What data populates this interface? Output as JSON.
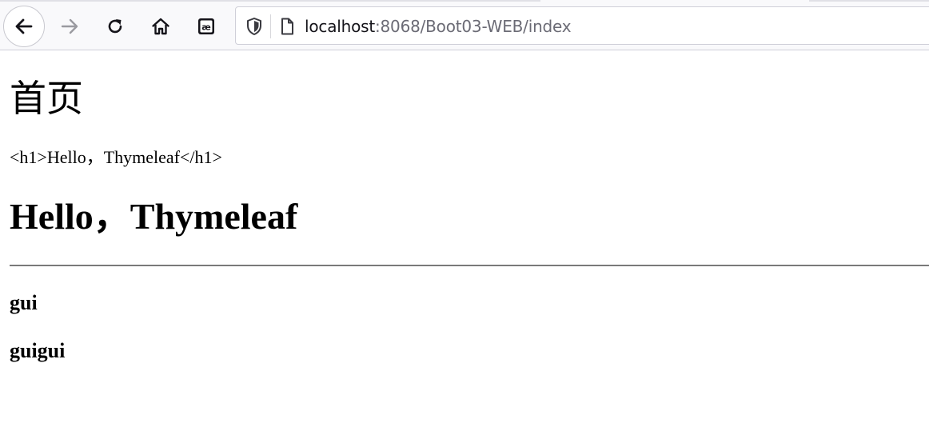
{
  "browser": {
    "url_host": "localhost",
    "url_rest": ":8068/Boot03-WEB/index",
    "buttons": {
      "back": "arrow-left-icon",
      "forward": "arrow-right-icon",
      "reload": "reload-icon",
      "home": "home-icon",
      "extension": "ae-extension-icon"
    },
    "forward_disabled": true
  },
  "page": {
    "title": "首页",
    "raw_text": "<h1>Hello，Thymeleaf</h1>",
    "heading": "Hello，Thymeleaf",
    "names": [
      "gui",
      "guigui"
    ]
  }
}
